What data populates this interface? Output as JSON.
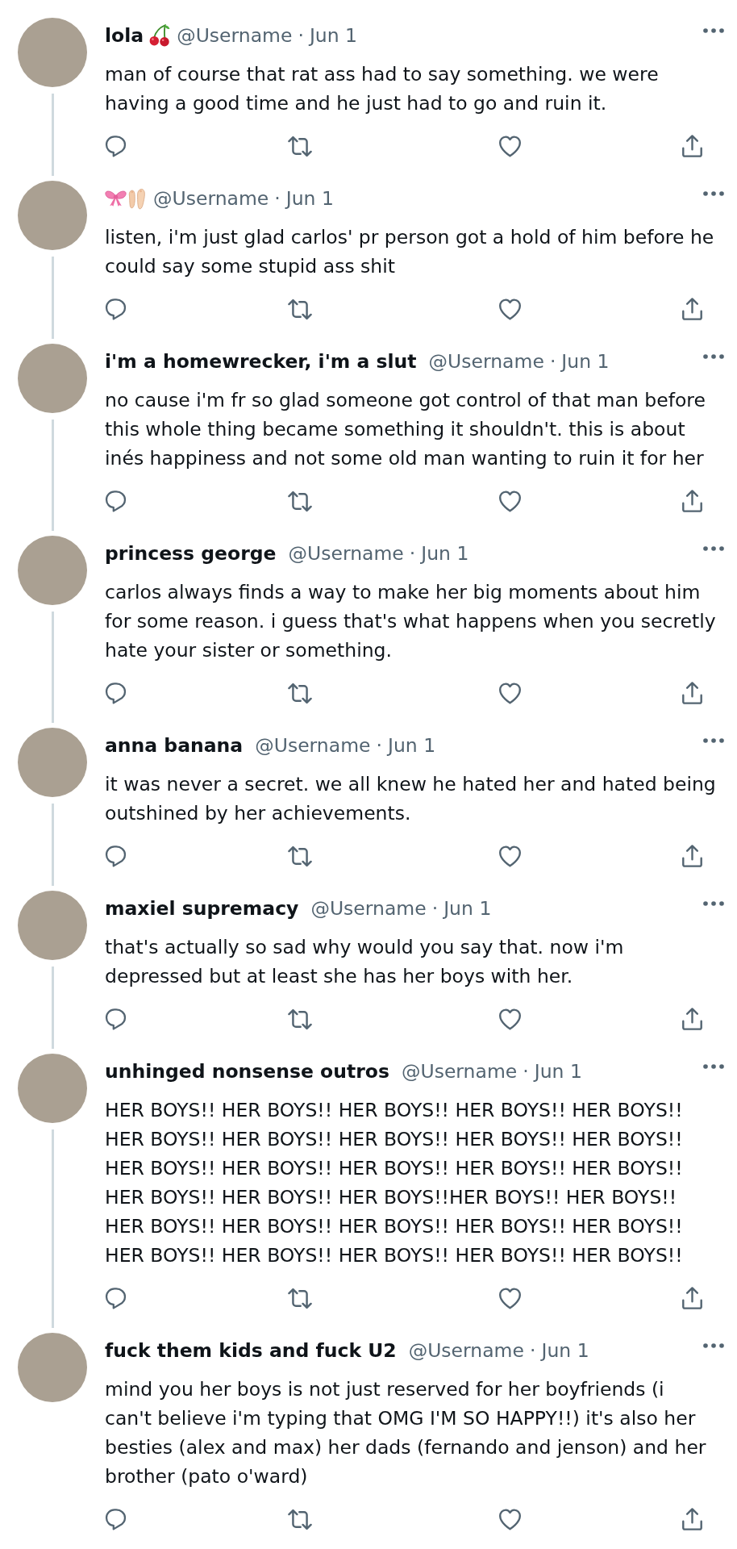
{
  "tweets": [
    {
      "name": "lola",
      "name_emoji": [
        {
          "kind": "cherry"
        }
      ],
      "handle": "@Username",
      "separator": "·",
      "time": "Jun 1",
      "text": "man of course that rat ass had to say something. we were having a good time and he just had to go and ruin it.",
      "connected": true
    },
    {
      "name_emoji": [
        {
          "kind": "bow"
        },
        {
          "kind": "feet"
        }
      ],
      "handle": "@Username",
      "separator": "·",
      "time": "Jun 1",
      "text": "listen, i'm just glad carlos' pr person got a hold of him before he could say some stupid ass shit",
      "connected": true
    },
    {
      "name": "i'm a homewrecker, i'm a slut",
      "handle": "@Username",
      "separator": "·",
      "time": "Jun 1",
      "text": "no cause i'm fr so glad someone got control of that man before this whole thing became something it shouldn't. this is about inés happiness and not some old man wanting to ruin it for her",
      "connected": true
    },
    {
      "name": "princess george",
      "handle": "@Username",
      "separator": "·",
      "time": "Jun 1",
      "text": "carlos always finds a way to make her big moments about him for some reason. i guess that's what happens when you secretly hate your sister or something.",
      "connected": true
    },
    {
      "name": "anna banana",
      "handle": "@Username",
      "separator": "·",
      "time": "Jun 1",
      "text": "it was never a secret. we all knew he hated her and hated being outshined by her achievements.",
      "connected": true
    },
    {
      "name": "maxiel supremacy",
      "handle": "@Username",
      "separator": "·",
      "time": "Jun 1",
      "text": "that's actually so sad why would you say that. now i'm depressed but at least she has her boys with her.",
      "connected": true
    },
    {
      "name": "unhinged nonsense outros",
      "handle": "@Username",
      "separator": "·",
      "time": "Jun 1",
      "text": "HER BOYS!! HER BOYS!! HER BOYS!! HER BOYS!! HER BOYS!! HER BOYS!! HER BOYS!! HER BOYS!! HER BOYS!! HER BOYS!! HER BOYS!! HER BOYS!! HER BOYS!! HER BOYS!! HER BOYS!! HER BOYS!! HER BOYS!! HER BOYS!!HER BOYS!! HER BOYS!! HER BOYS!! HER BOYS!! HER BOYS!! HER BOYS!! HER BOYS!! HER BOYS!! HER BOYS!! HER BOYS!! HER BOYS!! HER BOYS!!",
      "connected": true
    },
    {
      "name": "fuck them kids and fuck U2",
      "handle": "@Username",
      "separator": "·",
      "time": "Jun 1",
      "text": "mind you her boys is not just reserved for her boyfriends (i can't believe i'm typing that OMG I'M SO HAPPY!!) it's also her besties (alex and max) her dads (fernando and jenson) and her brother (pato o'ward)",
      "connected": false
    }
  ]
}
